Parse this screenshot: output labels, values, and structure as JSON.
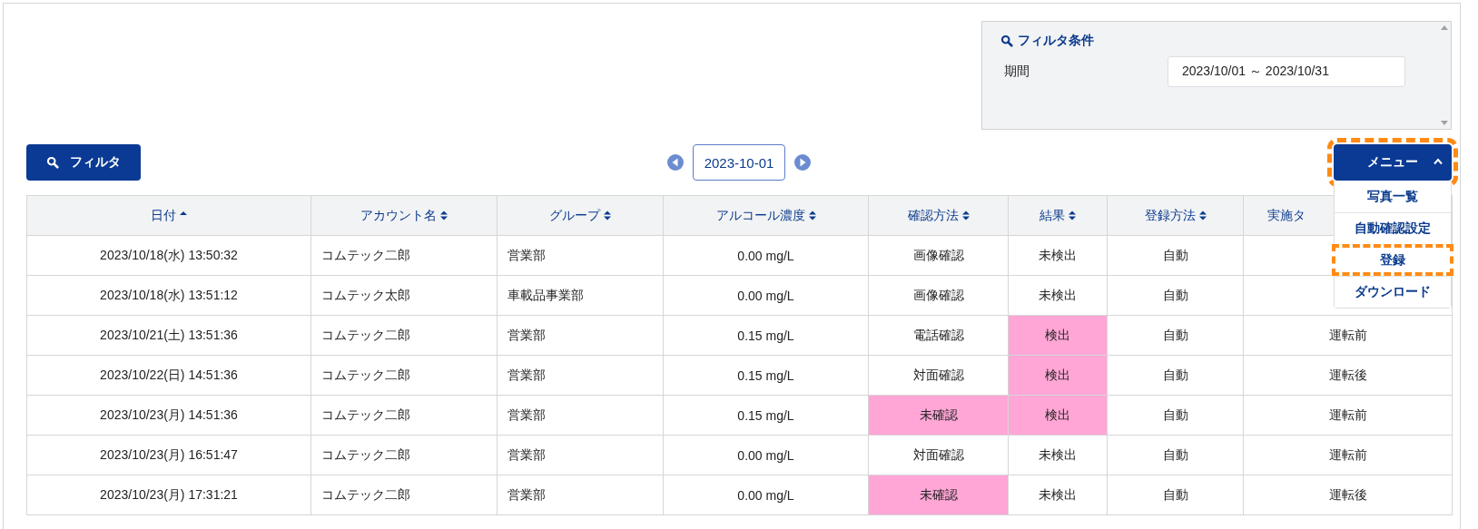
{
  "filter_panel": {
    "title": "フィルタ条件",
    "period_label": "期間",
    "period_value": "2023/10/01 ～ 2023/10/31"
  },
  "filter_button": {
    "label": "フィルタ"
  },
  "date_nav": {
    "value": "2023-10-01"
  },
  "menu": {
    "label": "メニュー",
    "expanded": true,
    "highlighted": true,
    "items": [
      {
        "label": "写真一覧",
        "highlighted": false
      },
      {
        "label": "自動確認設定",
        "highlighted": false
      },
      {
        "label": "登録",
        "highlighted": true
      },
      {
        "label": "ダウンロード",
        "highlighted": false
      }
    ]
  },
  "table": {
    "columns": [
      {
        "label": "日付",
        "sorted": true
      },
      {
        "label": "アカウント名",
        "sorted": false
      },
      {
        "label": "グループ",
        "sorted": false
      },
      {
        "label": "アルコール濃度",
        "sorted": false
      },
      {
        "label": "確認方法",
        "sorted": false
      },
      {
        "label": "結果",
        "sorted": false
      },
      {
        "label": "登録方法",
        "sorted": false
      },
      {
        "label": "実施タ"
      }
    ],
    "rows": [
      {
        "date": "2023/10/18(水) 13:50:32",
        "account": "コムテック二郎",
        "group": "営業部",
        "alcohol": "0.00 mg/L",
        "confirm_method": "画像確認",
        "confirm_flagged": false,
        "result": "未検出",
        "result_flagged": false,
        "registration": "自動"
      },
      {
        "date": "2023/10/18(水) 13:51:12",
        "account": "コムテック太郎",
        "group": "車載品事業部",
        "alcohol": "0.00 mg/L",
        "confirm_method": "画像確認",
        "confirm_flagged": false,
        "result": "未検出",
        "result_flagged": false,
        "registration": "自動"
      },
      {
        "date": "2023/10/21(土) 13:51:36",
        "account": "コムテック二郎",
        "group": "営業部",
        "alcohol": "0.15 mg/L",
        "confirm_method": "電話確認",
        "confirm_flagged": false,
        "result": "検出",
        "result_flagged": true,
        "registration": "自動",
        "timing": "運転前"
      },
      {
        "date": "2023/10/22(日) 14:51:36",
        "account": "コムテック二郎",
        "group": "営業部",
        "alcohol": "0.15 mg/L",
        "confirm_method": "対面確認",
        "confirm_flagged": false,
        "result": "検出",
        "result_flagged": true,
        "registration": "自動",
        "timing": "運転後"
      },
      {
        "date": "2023/10/23(月) 14:51:36",
        "account": "コムテック二郎",
        "group": "営業部",
        "alcohol": "0.15 mg/L",
        "confirm_method": "未確認",
        "confirm_flagged": true,
        "result": "検出",
        "result_flagged": true,
        "registration": "自動",
        "timing": "運転前"
      },
      {
        "date": "2023/10/23(月) 16:51:47",
        "account": "コムテック二郎",
        "group": "営業部",
        "alcohol": "0.00 mg/L",
        "confirm_method": "対面確認",
        "confirm_flagged": false,
        "result": "未検出",
        "result_flagged": false,
        "registration": "自動",
        "timing": "運転前"
      },
      {
        "date": "2023/10/23(月) 17:31:21",
        "account": "コムテック二郎",
        "group": "営業部",
        "alcohol": "0.00 mg/L",
        "confirm_method": "未確認",
        "confirm_flagged": true,
        "result": "未検出",
        "result_flagged": false,
        "registration": "自動",
        "timing": "運転後"
      }
    ]
  }
}
